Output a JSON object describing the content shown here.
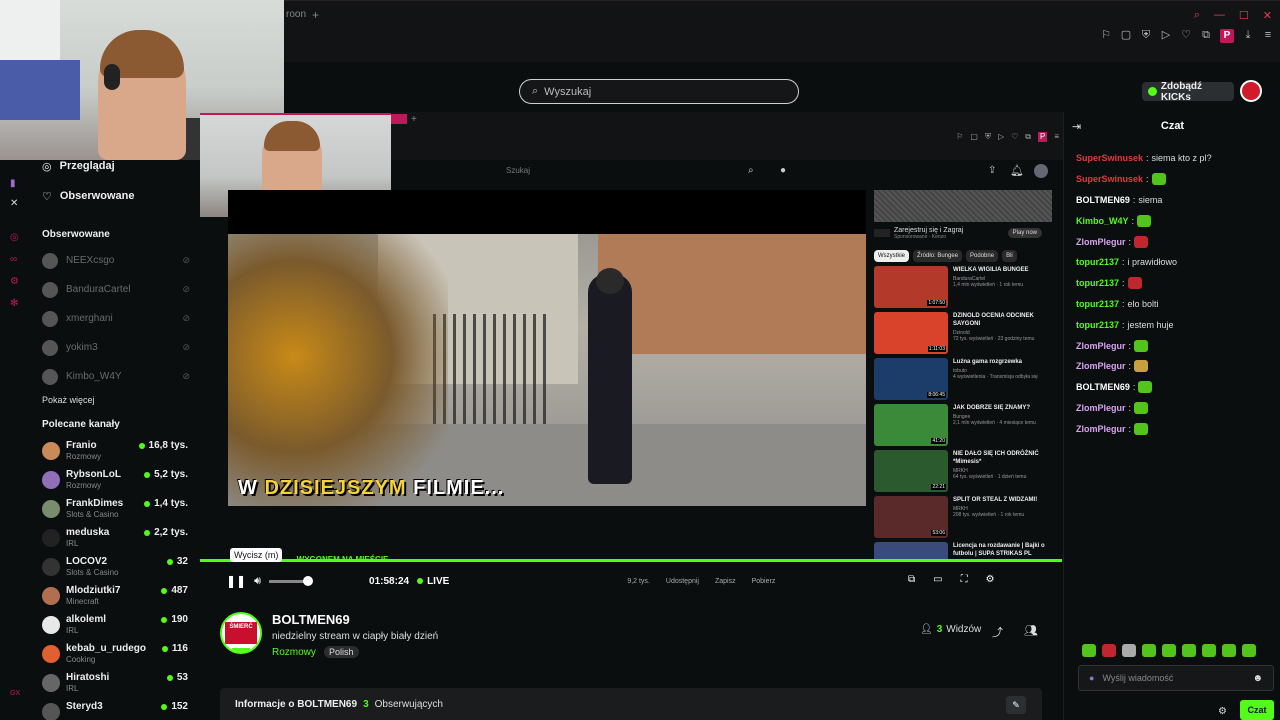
{
  "browser": {
    "tab_fragment": "roon",
    "window_controls": [
      "search-icon",
      "minimize-icon",
      "maximize-icon",
      "close-icon"
    ],
    "profile_letter": "P"
  },
  "search": {
    "placeholder": "Wyszukaj"
  },
  "header": {
    "kicks_label": "Zdobądź KICKs"
  },
  "sidebar": {
    "nav": [
      {
        "label": "Przeglądaj",
        "icon": "compass-icon"
      },
      {
        "label": "Obserwowane",
        "icon": "heart-icon"
      }
    ],
    "followed_title": "Obserwowane",
    "followed": [
      {
        "name": "NEEXcsgo"
      },
      {
        "name": "BanduraCartel"
      },
      {
        "name": "xmerghani"
      },
      {
        "name": "yokim3"
      },
      {
        "name": "Kimbo_W4Y"
      }
    ],
    "show_more": "Pokaż więcej",
    "recommended_title": "Polecane kanały",
    "recommended": [
      {
        "name": "Franio",
        "category": "Rozmowy",
        "viewers": "16,8 tys.",
        "color": "#c98a5a"
      },
      {
        "name": "RybsonLoL",
        "category": "Rozmowy",
        "viewers": "5,2 tys.",
        "color": "#8f6fb8"
      },
      {
        "name": "FrankDimes",
        "category": "Slots & Casino",
        "viewers": "1,4 tys.",
        "color": "#7a8c6e"
      },
      {
        "name": "meduska",
        "category": "IRL",
        "viewers": "2,2 tys.",
        "color": "#222222"
      },
      {
        "name": "LOCOV2",
        "category": "Slots & Casino",
        "viewers": "32",
        "color": "#333333"
      },
      {
        "name": "Mlodziutki7",
        "category": "Minecraft",
        "viewers": "487",
        "color": "#b07050"
      },
      {
        "name": "alkoleml",
        "category": "IRL",
        "viewers": "190",
        "color": "#e8e8e8"
      },
      {
        "name": "kebab_u_rudego",
        "category": "Cooking",
        "viewers": "116",
        "color": "#e06030"
      },
      {
        "name": "Hiratoshi",
        "category": "IRL",
        "viewers": "53",
        "color": "#666666"
      },
      {
        "name": "Steryd3",
        "category": "",
        "viewers": "152",
        "color": "#555555"
      }
    ]
  },
  "youtube": {
    "search_placeholder": "Szukaj",
    "ad": {
      "title": "Zarejestruj się i Zagraj",
      "sponsor": "Sponsorowane · Kenzo",
      "cta": "Play now"
    },
    "chips": [
      "Wszystkie",
      "Źródło: Bungee",
      "Podobne",
      "Bli"
    ],
    "videos": [
      {
        "title": "WIELKA WIGILIA BUNGEE",
        "channel": "BanduraCartel",
        "views": "1,4 mln wyświetleń · 1 rok temu",
        "duration": "1:07:50",
        "color": "#b33a2a"
      },
      {
        "title": "DZINOLD OCENIA ODCINEK SAYGONI",
        "channel": "Dzinold",
        "views": "72 tys. wyświetleń · 23 godziny temu",
        "duration": "1:11:03",
        "color": "#d9432c"
      },
      {
        "title": "Luźna gama rozgrzewka",
        "channel": "tobuto",
        "views": "4 wyświetlenia · Transmisja odbyła się",
        "duration": "8:06:45",
        "color": "#1c3c6a"
      },
      {
        "title": "JAK DOBRZE SIĘ ZNAMY?",
        "channel": "Bungee",
        "views": "2,1 mln wyświetleń · 4 miesiące temu",
        "duration": "41:20",
        "color": "#3a8a3a"
      },
      {
        "title": "NIE DAŁO SIĘ ICH ODRÓŻNIĆ *Mimesis*",
        "channel": "MRKH",
        "views": "64 tys. wyświetleń · 1 dzień temu",
        "duration": "22:21",
        "color": "#2a5a2e"
      },
      {
        "title": "SPLIT OR STEAL Z WIDZAMI!",
        "channel": "MRKH",
        "views": "208 tys. wyświetleń · 1 rok temu",
        "duration": "53:06",
        "color": "#5a2a2a"
      },
      {
        "title": "Licencja na rozdawanie | Bajki o futbolu | SUPA STRIKAS PL",
        "channel": "",
        "views": "",
        "duration": "",
        "color": "#3a4a7a"
      }
    ]
  },
  "player": {
    "caption_prefix": "W ",
    "caption_highlight": "DZISIEJSZYM",
    "caption_suffix": " FILMIE...",
    "ticker": "...WYGONEM NA MIEŚCIE",
    "tooltip": "Wycisz (m)",
    "time": "01:58:24",
    "live": "LIVE",
    "yt_actions": [
      "9,2 tys.",
      "Udostępnij",
      "Zapisz",
      "Pobierz"
    ]
  },
  "stream": {
    "avatar_text": "ŚMIERĆ",
    "name": "BOLTMEN69",
    "title": "niedzielny stream w ciapły biały dzień",
    "category": "Rozmowy",
    "tag": "Polish",
    "viewer_count": "3",
    "viewer_label": "Widzów",
    "info_title": "Informacje o BOLTMEN69",
    "followers_count": "3",
    "followers_label": "Obserwujących"
  },
  "chat": {
    "title": "Czat",
    "messages": [
      {
        "user": "SuperSwinusek",
        "text": "siema kto z pl?",
        "color": "#e03c3c",
        "emote": ""
      },
      {
        "user": "SuperSwinusek",
        "text": "",
        "color": "#e03c3c",
        "emote": "#53c41b"
      },
      {
        "user": "BOLTMEN69",
        "text": "siema",
        "color": "#ffffff",
        "emote": ""
      },
      {
        "user": "Kimbo_W4Y",
        "text": "",
        "color": "#53fc18",
        "emote": "#53c41b"
      },
      {
        "user": "ZlomPlegur",
        "text": "",
        "color": "#d9a3f0",
        "emote": "#c0262e"
      },
      {
        "user": "topur2137",
        "text": "i prawidłowo",
        "color": "#53fc18",
        "emote": ""
      },
      {
        "user": "topur2137",
        "text": "",
        "color": "#53fc18",
        "emote": "#c0262e"
      },
      {
        "user": "topur2137",
        "text": "elo bolti",
        "color": "#53fc18",
        "emote": ""
      },
      {
        "user": "topur2137",
        "text": "jestem huje",
        "color": "#53fc18",
        "emote": ""
      },
      {
        "user": "ZlomPlegur",
        "text": "",
        "color": "#d9a3f0",
        "emote": "#53c41b"
      },
      {
        "user": "ZlomPlegur",
        "text": "",
        "color": "#d9a3f0",
        "emote": "#c8a040"
      },
      {
        "user": "BOLTMEN69",
        "text": "",
        "color": "#ffffff",
        "emote": "#53c41b"
      },
      {
        "user": "ZlomPlegur",
        "text": "",
        "color": "#d9a3f0",
        "emote": "#53c41b"
      },
      {
        "user": "ZlomPlegur",
        "text": "",
        "color": "#d9a3f0",
        "emote": "#53c41b"
      }
    ],
    "input_placeholder": "Wyślij wiadomość",
    "send_label": "Czat"
  }
}
